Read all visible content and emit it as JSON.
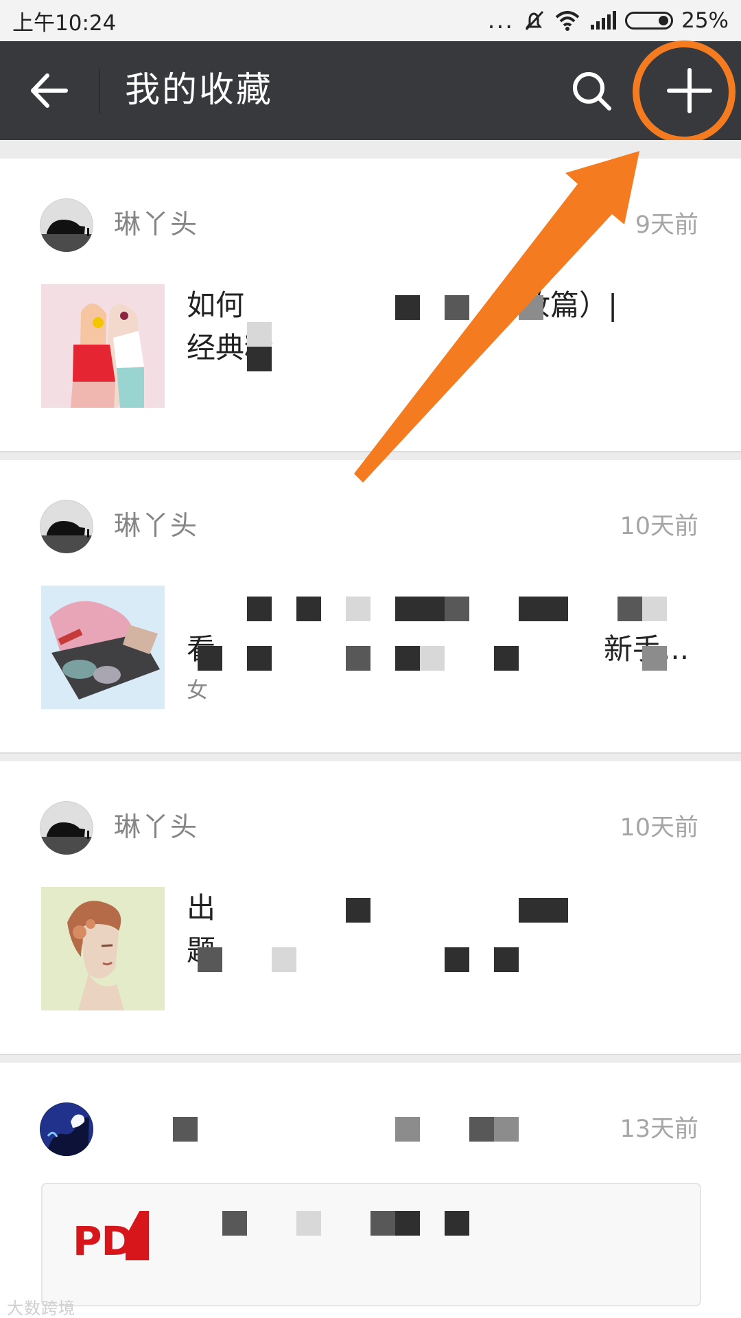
{
  "status": {
    "time": "上午10:24",
    "dots": "...",
    "battery": "25%"
  },
  "header": {
    "title": "我的收藏"
  },
  "favorites": [
    {
      "author": "琳丫头",
      "time": "9天前",
      "title_line1": "如何",
      "title_line1_end": "妆篇）|",
      "title_line2": "经典精"
    },
    {
      "author": "琳丫头",
      "time": "10天前",
      "title_line1": "",
      "title_line2": "看",
      "title_line2_end": "新手...",
      "summary": "女"
    },
    {
      "author": "琳丫头",
      "time": "10天前",
      "title_line1": "出",
      "title_line2": "题"
    },
    {
      "author": "",
      "time": "13天前",
      "file_type": "PD"
    }
  ],
  "watermark": "大数跨境"
}
